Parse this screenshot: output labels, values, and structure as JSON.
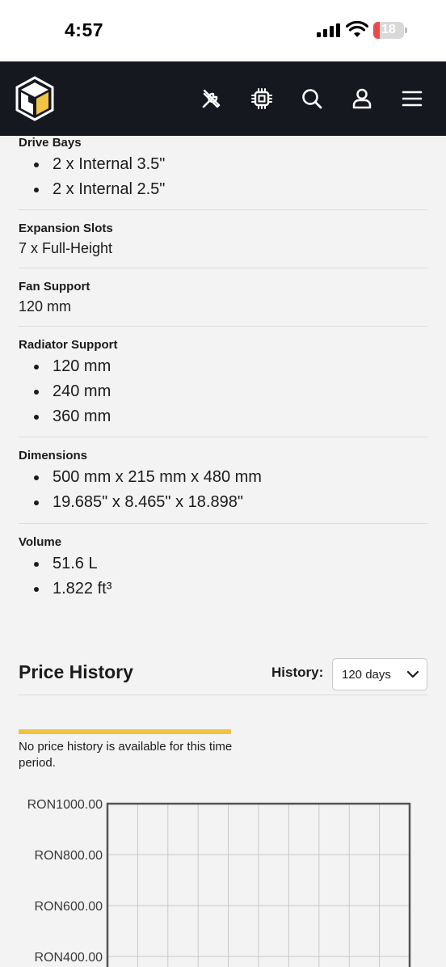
{
  "status_bar": {
    "time": "4:57",
    "battery_level": "18",
    "icons": [
      "signal-icon",
      "wifi-icon",
      "battery-icon"
    ]
  },
  "nav": {
    "icons": [
      "logo-cube-icon",
      "tools-icon",
      "cpu-chip-icon",
      "search-icon",
      "user-icon",
      "menu-icon"
    ],
    "background": "#161820"
  },
  "specs": {
    "drive_bays": {
      "label": "Drive Bays",
      "items": [
        "2 x Internal 3.5\"",
        "2 x Internal 2.5\""
      ]
    },
    "expansion_slots": {
      "label": "Expansion Slots",
      "value": "7 x Full-Height"
    },
    "fan_support": {
      "label": "Fan Support",
      "value": "120 mm"
    },
    "radiator_support": {
      "label": "Radiator Support",
      "items": [
        "120 mm",
        "240 mm",
        "360 mm"
      ]
    },
    "dimensions": {
      "label": "Dimensions",
      "items": [
        "500 mm x 215 mm x 480 mm",
        "19.685\" x 8.465\" x 18.898\""
      ]
    },
    "volume": {
      "label": "Volume",
      "items": [
        "51.6 L",
        "1.822 ft³"
      ]
    }
  },
  "price_history": {
    "title": "Price History",
    "history_label": "History:",
    "selected_range": "120 days",
    "notice": "No price history is available for this time period.",
    "accent_color": "#f0c343"
  },
  "chart_data": {
    "type": "line",
    "title": "",
    "xlabel": "",
    "ylabel": "",
    "y_ticks": [
      "RON1000.00",
      "RON800.00",
      "RON600.00",
      "RON400.00"
    ],
    "y_tick_values": [
      1000,
      800,
      600,
      400
    ],
    "ylim": [
      400,
      1000
    ],
    "x_gridlines": 9,
    "grid": true,
    "series": []
  }
}
